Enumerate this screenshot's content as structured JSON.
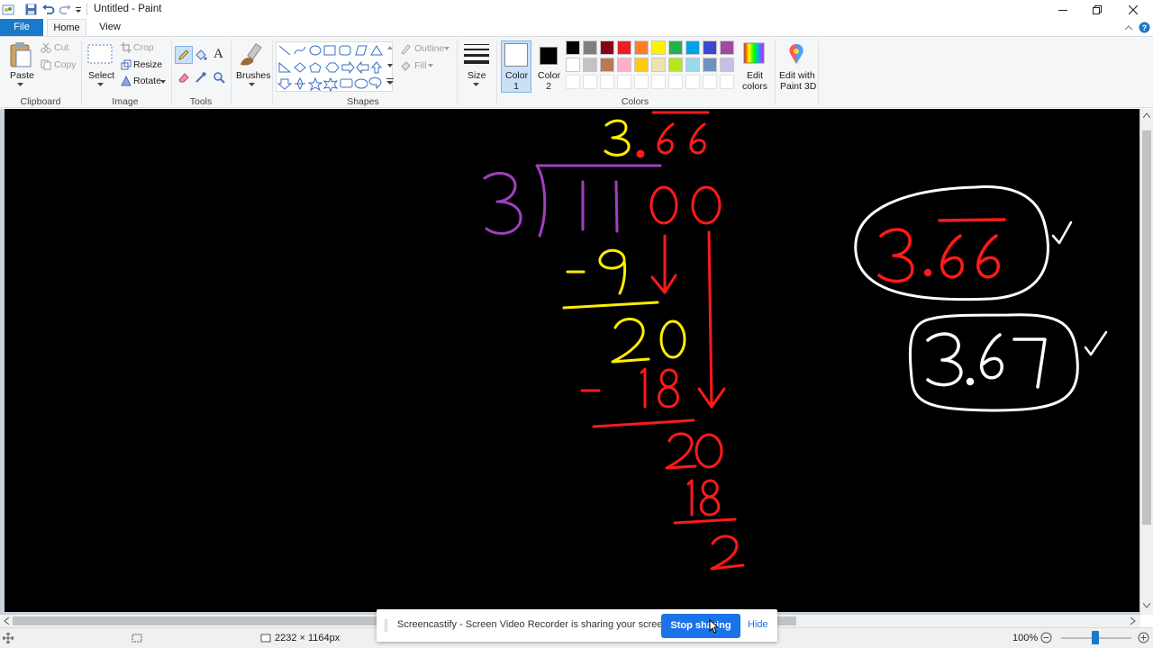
{
  "window": {
    "title": "Untitled - Paint",
    "controls": [
      "minimize",
      "restore",
      "close"
    ]
  },
  "tabs": {
    "file": "File",
    "home": "Home",
    "view": "View"
  },
  "ribbon": {
    "clipboard": {
      "paste": "Paste",
      "cut": "Cut",
      "copy": "Copy",
      "group": "Clipboard"
    },
    "image": {
      "select": "Select",
      "crop": "Crop",
      "resize": "Resize",
      "rotate": "Rotate",
      "group": "Image"
    },
    "tools": {
      "group": "Tools",
      "text_tool": "A"
    },
    "brushes": {
      "label": "Brushes"
    },
    "shapes": {
      "outline": "Outline",
      "fill": "Fill",
      "group": "Shapes"
    },
    "size": {
      "label": "Size"
    },
    "colors": {
      "color1": "Color 1",
      "color2": "Color 2",
      "edit_colors_1": "Edit",
      "edit_colors_2": "colors",
      "edit_3d_1": "Edit with",
      "edit_3d_2": "Paint 3D",
      "group": "Colors",
      "color1_value": "#ffffff",
      "color2_value": "#000000",
      "palette_row1": [
        "#000000",
        "#7f7f7f",
        "#880015",
        "#ed1c24",
        "#ff7f27",
        "#fff200",
        "#22b14c",
        "#00a2e8",
        "#3f48cc",
        "#a349a4"
      ],
      "palette_row2": [
        "#ffffff",
        "#c3c3c3",
        "#b97a57",
        "#ffaec9",
        "#ffc90e",
        "#efe4b0",
        "#b5e61d",
        "#99d9ea",
        "#7092be",
        "#c8bfe7"
      ]
    }
  },
  "canvas": {
    "background": "#000000",
    "ink_colors": {
      "yellow": "#ffee00",
      "red": "#ff1a1a",
      "purple": "#a040c0",
      "white": "#ffffff"
    },
    "quotient": "3.66",
    "divisor": "3",
    "dividend": "1100",
    "steps": [
      "-9",
      "20",
      "-18",
      "20",
      "18",
      "2"
    ],
    "answer_repeating": "3.66",
    "answer_rounded": "3.67",
    "checkmark": "✓"
  },
  "statusbar": {
    "dimensions": "2232 × 1164px",
    "zoom": "100%"
  },
  "sharebar": {
    "message": "Screencastify - Screen Video Recorder is sharing your screen.",
    "stop": "Stop sharing",
    "hide": "Hide"
  }
}
